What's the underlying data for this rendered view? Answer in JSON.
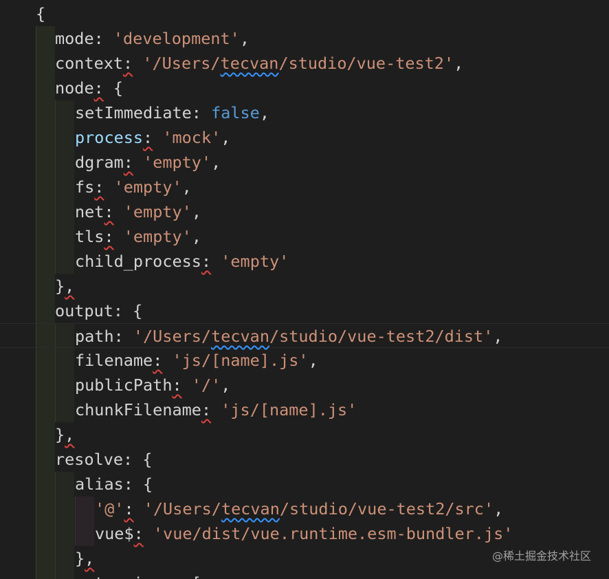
{
  "editor": {
    "theme": "dark",
    "colors": {
      "background": "#1e1e1e",
      "property": "#d4d4d4",
      "property_highlight": "#9cdcfe",
      "string": "#ce9178",
      "boolean": "#569cd6",
      "error_squiggle": "#e0443e",
      "spelling_squiggle": "#3794ff"
    },
    "lines": [
      {
        "indent": 0,
        "tokens": [
          {
            "text": "{",
            "type": "punct"
          }
        ]
      },
      {
        "indent": 1,
        "tokens": [
          {
            "text": "mode",
            "type": "key"
          },
          {
            "text": ": ",
            "type": "punct"
          },
          {
            "text": "'development'",
            "type": "string"
          },
          {
            "text": ",",
            "type": "punct"
          }
        ]
      },
      {
        "indent": 1,
        "tokens": [
          {
            "text": "context",
            "type": "key"
          },
          {
            "text": ":",
            "type": "punct",
            "err": "red"
          },
          {
            "text": " ",
            "type": "punct"
          },
          {
            "text": "'/Users/",
            "type": "string"
          },
          {
            "text": "tecvan",
            "type": "string",
            "err": "blue"
          },
          {
            "text": "/studio/vue-test2'",
            "type": "string"
          },
          {
            "text": ",",
            "type": "punct"
          }
        ]
      },
      {
        "indent": 1,
        "tokens": [
          {
            "text": "node",
            "type": "key"
          },
          {
            "text": ":",
            "type": "punct",
            "err": "red"
          },
          {
            "text": " {",
            "type": "punct"
          }
        ]
      },
      {
        "indent": 2,
        "tokens": [
          {
            "text": "setImmediate",
            "type": "key"
          },
          {
            "text": ": ",
            "type": "punct"
          },
          {
            "text": "false",
            "type": "bool"
          },
          {
            "text": ",",
            "type": "punct"
          }
        ]
      },
      {
        "indent": 2,
        "tokens": [
          {
            "text": "process",
            "type": "key-blue"
          },
          {
            "text": ":",
            "type": "punct",
            "err": "red"
          },
          {
            "text": " ",
            "type": "punct"
          },
          {
            "text": "'mock'",
            "type": "string"
          },
          {
            "text": ",",
            "type": "punct"
          }
        ]
      },
      {
        "indent": 2,
        "tokens": [
          {
            "text": "dgram",
            "type": "key"
          },
          {
            "text": ":",
            "type": "punct",
            "err": "red"
          },
          {
            "text": " ",
            "type": "punct"
          },
          {
            "text": "'empty'",
            "type": "string"
          },
          {
            "text": ",",
            "type": "punct"
          }
        ]
      },
      {
        "indent": 2,
        "tokens": [
          {
            "text": "fs",
            "type": "key"
          },
          {
            "text": ":",
            "type": "punct",
            "err": "red"
          },
          {
            "text": " ",
            "type": "punct"
          },
          {
            "text": "'empty'",
            "type": "string"
          },
          {
            "text": ",",
            "type": "punct"
          }
        ]
      },
      {
        "indent": 2,
        "tokens": [
          {
            "text": "net",
            "type": "key"
          },
          {
            "text": ":",
            "type": "punct",
            "err": "red"
          },
          {
            "text": " ",
            "type": "punct"
          },
          {
            "text": "'empty'",
            "type": "string"
          },
          {
            "text": ",",
            "type": "punct"
          }
        ]
      },
      {
        "indent": 2,
        "tokens": [
          {
            "text": "tls",
            "type": "key"
          },
          {
            "text": ":",
            "type": "punct",
            "err": "red"
          },
          {
            "text": " ",
            "type": "punct"
          },
          {
            "text": "'empty'",
            "type": "string"
          },
          {
            "text": ",",
            "type": "punct"
          }
        ]
      },
      {
        "indent": 2,
        "tokens": [
          {
            "text": "child_process",
            "type": "key"
          },
          {
            "text": ":",
            "type": "punct",
            "err": "red"
          },
          {
            "text": " ",
            "type": "punct"
          },
          {
            "text": "'empty'",
            "type": "string"
          }
        ]
      },
      {
        "indent": 1,
        "tokens": [
          {
            "text": "}",
            "type": "punct"
          },
          {
            "text": ",",
            "type": "punct",
            "err": "red"
          }
        ]
      },
      {
        "indent": 1,
        "tokens": [
          {
            "text": "output",
            "type": "key"
          },
          {
            "text": ": {",
            "type": "punct"
          }
        ]
      },
      {
        "indent": 2,
        "current": true,
        "tokens": [
          {
            "text": "path",
            "type": "key"
          },
          {
            "text": ": ",
            "type": "punct"
          },
          {
            "text": "'/Users/",
            "type": "string"
          },
          {
            "text": "tecvan",
            "type": "string",
            "err": "blue"
          },
          {
            "text": "/studio/vue-test2/dist'",
            "type": "string"
          },
          {
            "text": ",",
            "type": "punct"
          }
        ]
      },
      {
        "indent": 2,
        "tokens": [
          {
            "text": "filename",
            "type": "key"
          },
          {
            "text": ":",
            "type": "punct",
            "err": "red"
          },
          {
            "text": " ",
            "type": "punct"
          },
          {
            "text": "'js/[name].js'",
            "type": "string"
          },
          {
            "text": ",",
            "type": "punct"
          }
        ]
      },
      {
        "indent": 2,
        "tokens": [
          {
            "text": "publicPath",
            "type": "key"
          },
          {
            "text": ":",
            "type": "punct",
            "err": "red"
          },
          {
            "text": " ",
            "type": "punct"
          },
          {
            "text": "'/'",
            "type": "string"
          },
          {
            "text": ",",
            "type": "punct"
          }
        ]
      },
      {
        "indent": 2,
        "tokens": [
          {
            "text": "chunkFilename",
            "type": "key"
          },
          {
            "text": ":",
            "type": "punct",
            "err": "red"
          },
          {
            "text": " ",
            "type": "punct"
          },
          {
            "text": "'js/[name].js'",
            "type": "string"
          }
        ]
      },
      {
        "indent": 1,
        "tokens": [
          {
            "text": "}",
            "type": "punct"
          },
          {
            "text": ",",
            "type": "punct",
            "err": "red"
          }
        ]
      },
      {
        "indent": 1,
        "tokens": [
          {
            "text": "resolve",
            "type": "key"
          },
          {
            "text": ": {",
            "type": "punct"
          }
        ]
      },
      {
        "indent": 2,
        "tokens": [
          {
            "text": "alias",
            "type": "key"
          },
          {
            "text": ": {",
            "type": "punct"
          }
        ]
      },
      {
        "indent": 3,
        "tokens": [
          {
            "text": "'@'",
            "type": "string"
          },
          {
            "text": ":",
            "type": "punct",
            "err": "red"
          },
          {
            "text": " ",
            "type": "punct"
          },
          {
            "text": "'/Users/",
            "type": "string"
          },
          {
            "text": "tecvan",
            "type": "string",
            "err": "blue"
          },
          {
            "text": "/studio/vue-test2/src'",
            "type": "string"
          },
          {
            "text": ",",
            "type": "punct"
          }
        ]
      },
      {
        "indent": 3,
        "tokens": [
          {
            "text": "vue$",
            "type": "key"
          },
          {
            "text": ":",
            "type": "punct",
            "err": "red"
          },
          {
            "text": " ",
            "type": "punct"
          },
          {
            "text": "'vue/dist/vue.runtime.esm-bundler.js'",
            "type": "string"
          }
        ]
      },
      {
        "indent": 2,
        "tokens": [
          {
            "text": "}",
            "type": "punct"
          },
          {
            "text": ",",
            "type": "punct",
            "err": "red"
          }
        ]
      },
      {
        "indent": 2,
        "tokens": [
          {
            "text": "extensions: [",
            "type": "key"
          }
        ]
      }
    ]
  },
  "watermark": "@稀土掘金技术社区"
}
